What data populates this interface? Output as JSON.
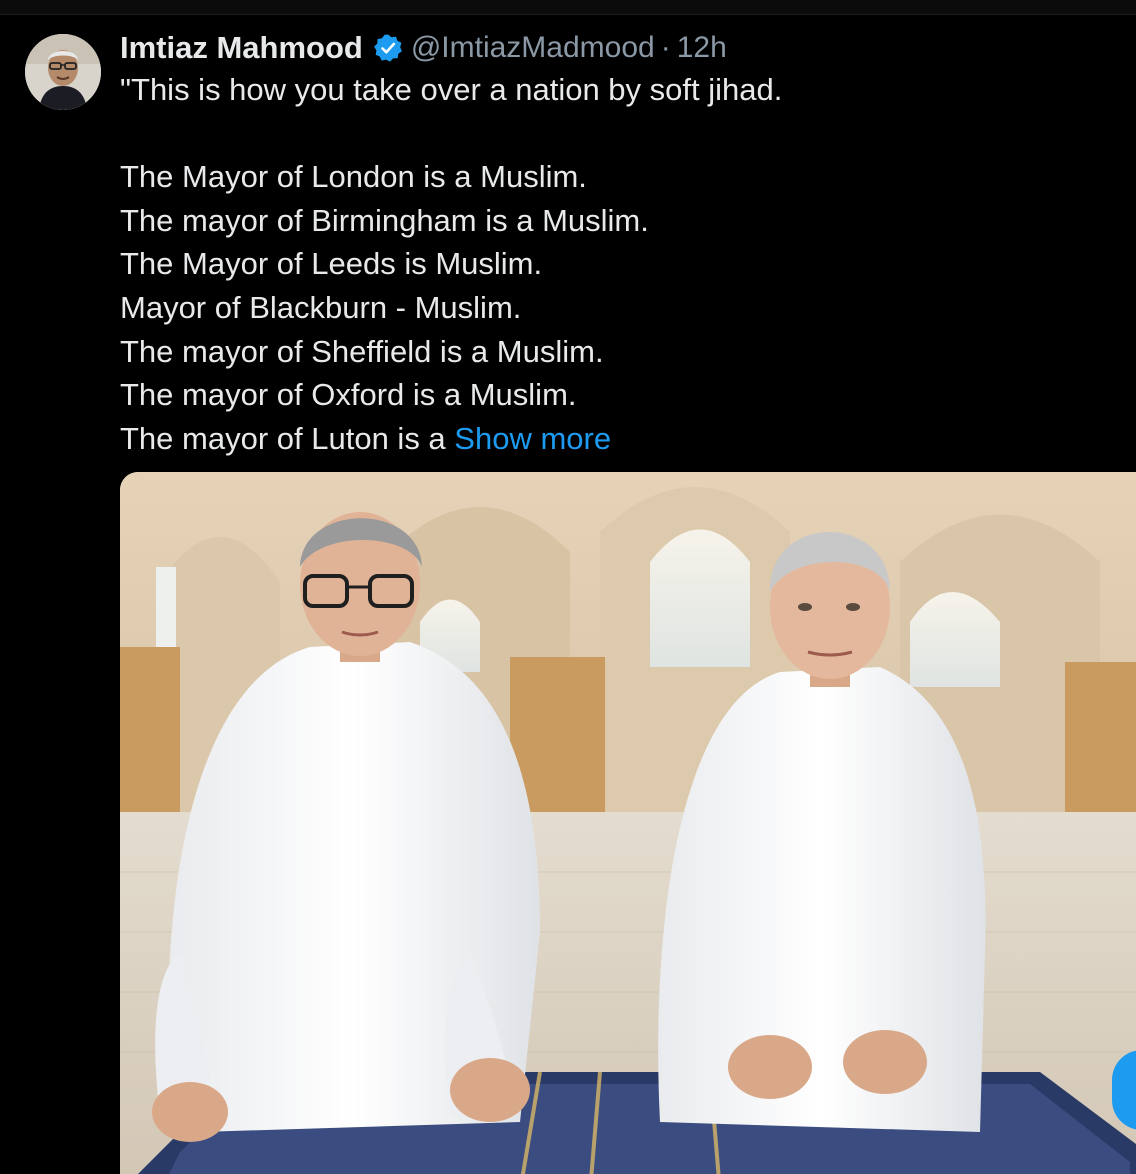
{
  "tweet": {
    "author": {
      "display_name": "Imtiaz Mahmood",
      "handle": "@ImtiazMadmood",
      "separator": "·",
      "time": "12h",
      "verified": true,
      "avatar_icon": "user-avatar"
    },
    "lines": [
      "\"This is how you take over a nation by soft jihad.",
      "",
      "The Mayor of London is a Muslim.",
      "The mayor of Birmingham is a Muslim.",
      "The Mayor of Leeds is Muslim.",
      "Mayor of Blackburn - Muslim.",
      "The mayor of Sheffield is a Muslim.",
      "The mayor of Oxford is a Muslim."
    ],
    "last_line_prefix": "The mayor of Luton is a ",
    "show_more_label": "Show more",
    "media": {
      "type": "photo",
      "icon": "photo-image"
    }
  },
  "colors": {
    "background": "#000000",
    "text": "#e7e9ea",
    "secondary": "#8b98a5",
    "accent": "#1d9bf0"
  }
}
